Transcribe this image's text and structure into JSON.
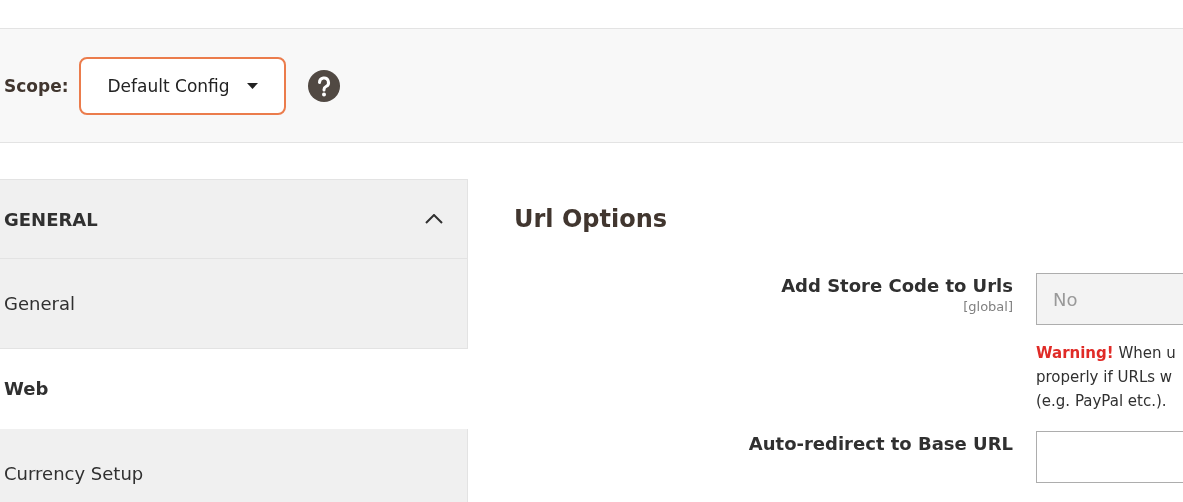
{
  "toolbar": {
    "scope_label": "Scope:",
    "scope_select": {
      "value": "Default Config"
    }
  },
  "sidebar": {
    "section": {
      "title": "GENERAL",
      "expanded": true
    },
    "items": [
      {
        "label": "General",
        "selected": false
      },
      {
        "label": "Web",
        "selected": true
      },
      {
        "label": "Currency Setup",
        "selected": false
      }
    ]
  },
  "main": {
    "title": "Url Options",
    "fields": [
      {
        "label": "Add Store Code to Urls",
        "scope": "[global]",
        "value": "No",
        "disabled": true,
        "warning": {
          "emphasis": "Warning!",
          "lines": [
            "When u",
            "properly if URLs w",
            "(e.g. PayPal etc.)."
          ]
        }
      },
      {
        "label": "Auto-redirect to Base URL",
        "disabled": false
      }
    ]
  }
}
